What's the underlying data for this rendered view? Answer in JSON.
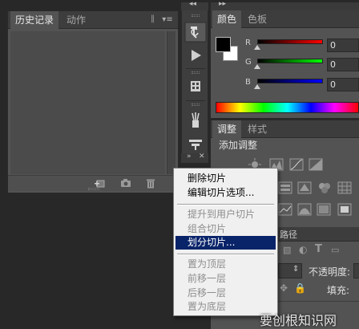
{
  "history_panel": {
    "tabs": [
      {
        "label": "历史记录",
        "active": true
      },
      {
        "label": "动作",
        "active": false
      }
    ],
    "collapse_glyph": "»",
    "menu_glyph": "▾≡",
    "footer_icons": [
      "new-snapshot-icon",
      "camera-icon",
      "trash-icon"
    ]
  },
  "tool_strip": {
    "collapse_glyph": "◂◂",
    "close_glyph": "✕",
    "expand_glyph": "»",
    "tools": [
      "history-brush-icon",
      "play-action-icon",
      "swatches-icon",
      "brush-presets-icon",
      "tool-presets-icon"
    ]
  },
  "color_panel": {
    "tabs": [
      {
        "label": "颜色",
        "active": true
      },
      {
        "label": "色板",
        "active": false
      }
    ],
    "collapse_glyph": "▸▸",
    "channels": [
      {
        "label": "R",
        "value": "0",
        "color": "#ff0000"
      },
      {
        "label": "G",
        "value": "0",
        "color": "#00ff00"
      },
      {
        "label": "B",
        "value": "0",
        "color": "#0000ff"
      }
    ],
    "foreground": "#000000",
    "background": "#ffffff"
  },
  "adjustments_panel": {
    "tabs": [
      {
        "label": "调整",
        "active": true
      },
      {
        "label": "样式",
        "active": false
      }
    ],
    "title": "添加调整"
  },
  "layers_panel": {
    "tab_fragment": "路径",
    "opacity_label": "不透明度:",
    "fill_label": "填充:"
  },
  "context_menu": {
    "items": [
      {
        "label": "删除切片",
        "enabled": true,
        "highlighted": false
      },
      {
        "label": "编辑切片选项...",
        "enabled": true,
        "highlighted": false
      },
      {
        "separator": true
      },
      {
        "label": "提升到用户切片",
        "enabled": false,
        "highlighted": false
      },
      {
        "label": "组合切片",
        "enabled": false,
        "highlighted": false
      },
      {
        "label": "划分切片...",
        "enabled": true,
        "highlighted": true
      },
      {
        "separator": true
      },
      {
        "label": "置为顶层",
        "enabled": false,
        "highlighted": false
      },
      {
        "label": "前移一层",
        "enabled": false,
        "highlighted": false
      },
      {
        "label": "后移一层",
        "enabled": false,
        "highlighted": false
      },
      {
        "label": "置为底层",
        "enabled": false,
        "highlighted": false
      }
    ]
  },
  "watermark": "要创根知识网"
}
